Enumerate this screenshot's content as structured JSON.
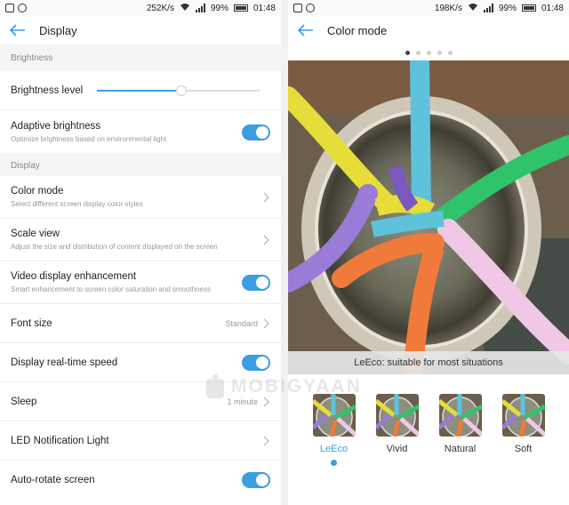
{
  "left": {
    "status": {
      "speed": "252K/s",
      "battery": "99%",
      "time": "01:48"
    },
    "title": "Display",
    "sections": {
      "brightness": "Brightness",
      "display": "Display"
    },
    "rows": {
      "brightness_level": {
        "label": "Brightness level",
        "value": 0.52
      },
      "adaptive": {
        "label": "Adaptive brightness",
        "desc": "Optimize brightness based on environmental light",
        "on": true
      },
      "color_mode": {
        "label": "Color mode",
        "desc": "Select different screen display color styles"
      },
      "scale_view": {
        "label": "Scale view",
        "desc": "Adjust the size and distribution of content displayed on the screen"
      },
      "video": {
        "label": "Video display enhancement",
        "desc": "Smart enhancement to screen color saturation and smoothness",
        "on": true
      },
      "font_size": {
        "label": "Font size",
        "value": "Standard"
      },
      "realtime": {
        "label": "Display real-time speed",
        "on": true
      },
      "sleep": {
        "label": "Sleep",
        "value": "1 minute"
      },
      "led": {
        "label": "LED Notification Light"
      },
      "autorotate": {
        "label": "Auto-rotate screen",
        "on": true
      }
    }
  },
  "right": {
    "status": {
      "speed": "198K/s",
      "battery": "99%",
      "time": "01:48"
    },
    "title": "Color mode",
    "page_indicator": {
      "count": 5,
      "active": 1
    },
    "caption": "LeEco: suitable for most situations",
    "modes": [
      {
        "label": "LeEco",
        "selected": true
      },
      {
        "label": "Vivid",
        "selected": false
      },
      {
        "label": "Natural",
        "selected": false
      },
      {
        "label": "Soft",
        "selected": false
      }
    ]
  },
  "watermark": "MOBIGYAAN",
  "colors": {
    "accent": "#3a9ee0",
    "section_bg": "#f5f5f5"
  }
}
